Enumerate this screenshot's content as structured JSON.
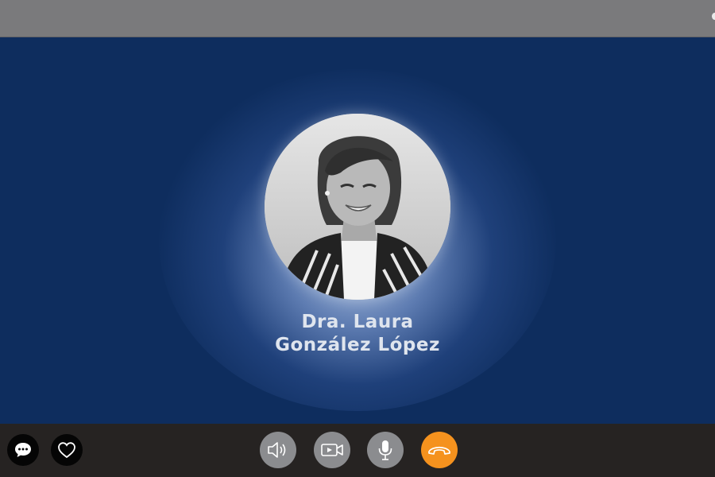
{
  "caller": {
    "name_line1": "Dra. Laura",
    "name_line2": "González López"
  },
  "icons": {
    "chat": "chat-bubble-icon",
    "favorite": "heart-icon",
    "speaker": "speaker-icon",
    "camera": "video-camera-icon",
    "microphone": "microphone-icon",
    "hangup": "phone-hangup-icon"
  },
  "colors": {
    "call_background": "#0e2d5e",
    "top_bar": "#7a7a7c",
    "toolbar": "#262322",
    "control_button": "#8b8c8f",
    "hangup_button": "#f5921e",
    "name_text": "#dfe5ee"
  }
}
